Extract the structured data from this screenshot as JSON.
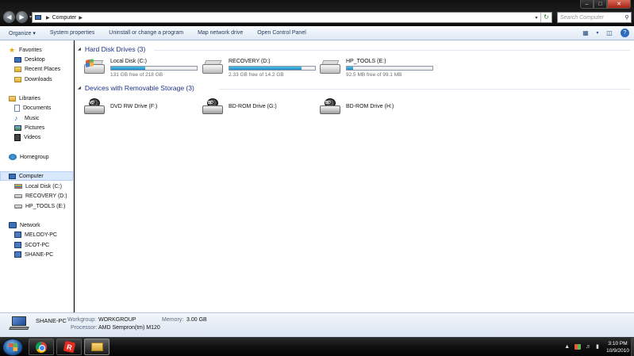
{
  "window": {
    "breadcrumb": [
      "Computer"
    ],
    "search_placeholder": "Search Computer",
    "controls": {
      "minimize": "–",
      "maximize": "□",
      "close": "✕"
    }
  },
  "commands": [
    "Organize ▾",
    "System properties",
    "Uninstall or change a program",
    "Map network drive",
    "Open Control Panel"
  ],
  "nav_pane": {
    "favorites": {
      "label": "Favorites",
      "items": [
        "Desktop",
        "Recent Places",
        "Downloads"
      ]
    },
    "libraries": {
      "label": "Libraries",
      "items": [
        "Documents",
        "Music",
        "Pictures",
        "Videos"
      ]
    },
    "homegroup": "Homegroup",
    "computer": {
      "label": "Computer",
      "items": [
        "Local Disk (C:)",
        "RECOVERY (D:)",
        "HP_TOOLS (E:)"
      ]
    },
    "network": {
      "label": "Network",
      "items": [
        "MELODY-PC",
        "SCOT-PC",
        "SHANE-PC"
      ]
    }
  },
  "hard_disks": {
    "header": "Hard Disk Drives (3)",
    "drives": [
      {
        "name": "Local Disk (C:)",
        "free": "131 GB free of 218 GB",
        "used_fraction": 0.4
      },
      {
        "name": "RECOVERY (D:)",
        "free": "2.33 GB free of 14.2 GB",
        "used_fraction": 0.84
      },
      {
        "name": "HP_TOOLS (E:)",
        "free": "92.5 MB free of 99.1 MB",
        "used_fraction": 0.07
      }
    ]
  },
  "removable": {
    "header": "Devices with Removable Storage (3)",
    "drives": [
      {
        "name": "DVD RW Drive (F:)",
        "badge": "DVD"
      },
      {
        "name": "BD-ROM Drive (G:)",
        "badge": "BD"
      },
      {
        "name": "BD-ROM Drive (H:)",
        "badge": "BD"
      }
    ]
  },
  "details": {
    "computer_name": "SHANE-PC",
    "workgroup_label": "Workgroup:",
    "workgroup": "WORKGROUP",
    "memory_label": "Memory:",
    "memory": "3.00 GB",
    "processor_label": "Processor:",
    "processor": "AMD Sempron(tm) M120"
  },
  "taskbar": {
    "time": "3:10 PM",
    "date": "10/9/2010",
    "pinned": [
      "chrome-icon",
      "roblox-icon",
      "explorer-icon"
    ]
  }
}
